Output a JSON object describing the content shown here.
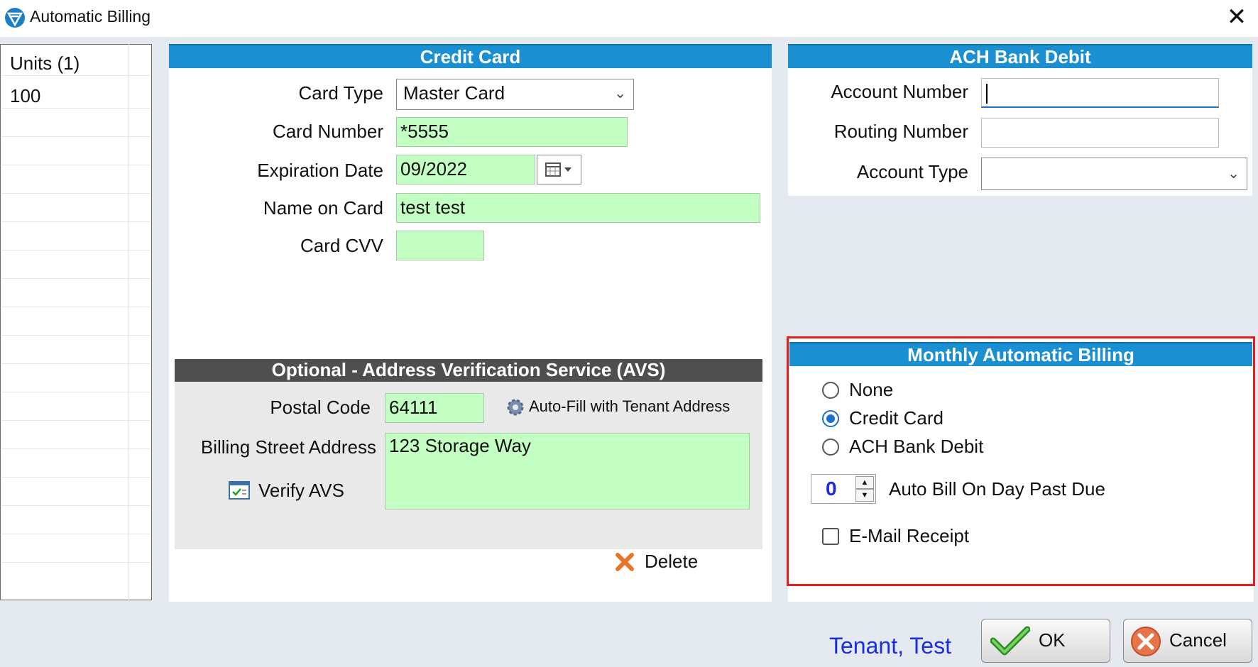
{
  "window": {
    "title": "Automatic Billing",
    "close_glyph": "✕"
  },
  "units": {
    "header": "Units (1)",
    "rows": [
      "100"
    ]
  },
  "credit_card": {
    "header": "Credit Card",
    "card_type_label": "Card Type",
    "card_type_value": "Master Card",
    "card_number_label": "Card Number",
    "card_number_value": "*5555",
    "expiration_label": "Expiration Date",
    "expiration_value": "09/2022",
    "name_label": "Name on Card",
    "name_value": "test test",
    "cvv_label": "Card CVV",
    "cvv_value": ""
  },
  "avs": {
    "header": "Optional - Address Verification Service (AVS)",
    "postal_label": "Postal Code",
    "postal_value": "64111",
    "autofill_label": "Auto-Fill with Tenant Address",
    "street_label": "Billing Street Address",
    "street_value": "123 Storage Way",
    "verify_label": "Verify AVS"
  },
  "delete_label": "Delete",
  "ach": {
    "header": "ACH Bank Debit",
    "account_number_label": "Account Number",
    "account_number_value": "",
    "routing_number_label": "Routing Number",
    "routing_number_value": "",
    "account_type_label": "Account Type",
    "account_type_value": ""
  },
  "monthly": {
    "header": "Monthly Automatic Billing",
    "options": [
      "None",
      "Credit Card",
      "ACH Bank Debit"
    ],
    "selected": "Credit Card",
    "day_value": "0",
    "day_label": "Auto Bill On Day Past Due",
    "email_receipt_label": "E-Mail Receipt",
    "email_receipt_checked": false
  },
  "tenant_name": "Tenant, Test",
  "buttons": {
    "ok": "OK",
    "cancel": "Cancel"
  },
  "colors": {
    "header_blue": "#1a8fd2",
    "field_green": "#c3ffc3",
    "highlight_red": "#e51d1d",
    "tenant_blue": "#1a2ee0"
  }
}
